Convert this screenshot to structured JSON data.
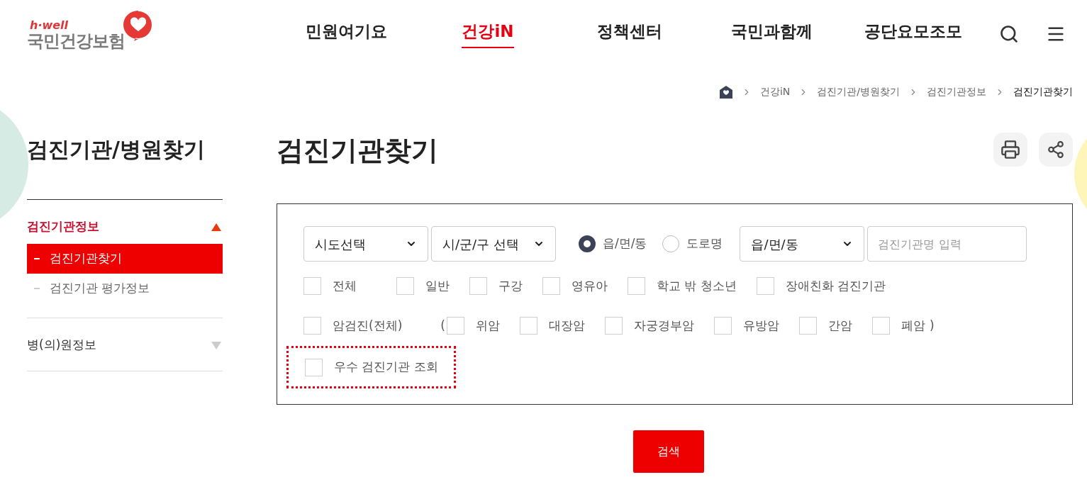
{
  "header": {
    "logo": {
      "tagline": "h·well",
      "name": "국민건강보험"
    },
    "nav": [
      {
        "label": "민원여기요",
        "selected": false
      },
      {
        "label": "건강iN",
        "selected": true
      },
      {
        "label": "정책센터",
        "selected": false
      },
      {
        "label": "국민과함께",
        "selected": false
      },
      {
        "label": "공단요모조모",
        "selected": false
      }
    ]
  },
  "breadcrumb": [
    "건강iN",
    "검진기관/병원찾기",
    "검진기관정보",
    "검진기관찾기"
  ],
  "sidebar": {
    "title": "검진기관/병원찾기",
    "items": [
      {
        "label": "검진기관정보",
        "expanded": true,
        "children": [
          {
            "label": "검진기관찾기",
            "selected": true
          },
          {
            "label": "검진기관 평가정보",
            "selected": false
          }
        ]
      },
      {
        "label": "병(의)원정보",
        "expanded": false
      }
    ]
  },
  "page_title": "검진기관찾기",
  "form": {
    "selects": [
      "시도선택",
      "시/군/구 선택"
    ],
    "radios": [
      {
        "label": "읍/면/동",
        "selected": true
      },
      {
        "label": "도로명",
        "selected": false
      }
    ],
    "dong_select": "읍/면/동",
    "name_field": {
      "placeholder": "검진기관명 입력"
    },
    "type_checks": [
      {
        "label": "전체",
        "checked": false
      },
      {
        "label": "일반",
        "checked": false
      },
      {
        "label": "구강",
        "checked": false
      },
      {
        "label": "영유아",
        "checked": false
      },
      {
        "label": "학교 밖 청소년",
        "checked": false
      },
      {
        "label": "장애친화 검진기관",
        "checked": false
      }
    ],
    "cancer_all": {
      "label": "암검진(전체)",
      "checked": false
    },
    "cancer_open": "(",
    "cancer_checks": [
      {
        "label": "위암",
        "checked": false
      },
      {
        "label": "대장암",
        "checked": false
      },
      {
        "label": "자궁경부암",
        "checked": false
      },
      {
        "label": "유방암",
        "checked": false
      },
      {
        "label": "간암",
        "checked": false
      },
      {
        "label": "폐암",
        "checked": false
      }
    ],
    "cancer_close": ")",
    "excellent": {
      "label": "우수 검진기관 조회",
      "checked": false,
      "highlighted": true
    }
  },
  "search_button": "검색"
}
